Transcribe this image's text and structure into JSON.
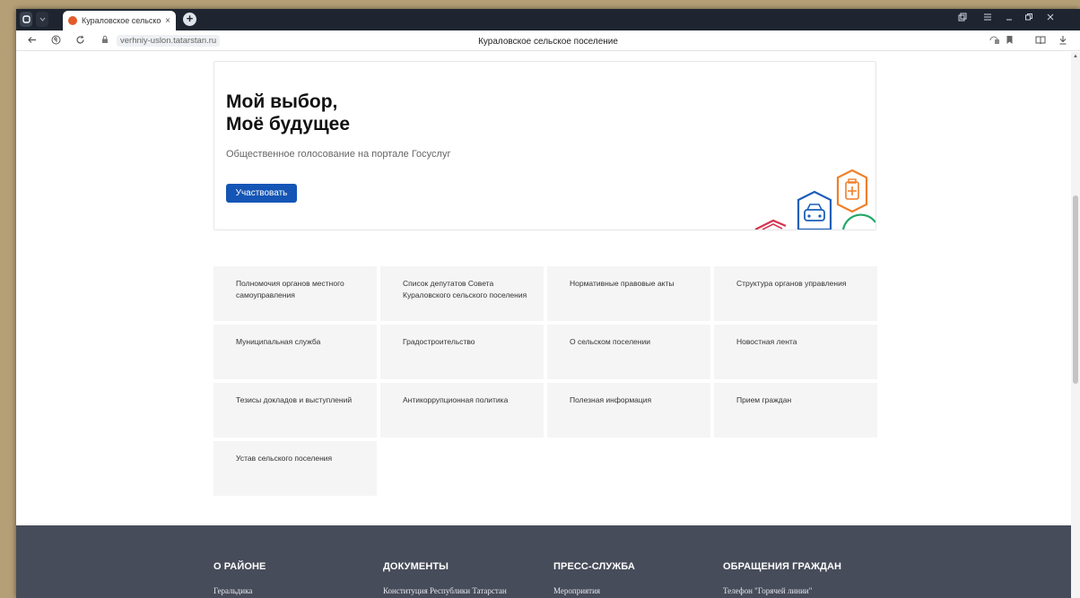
{
  "browser": {
    "tab_title": "Кураловское сельское",
    "tab_close": "×",
    "new_tab": "+",
    "url": "verhniy-uslon.tatarstan.ru",
    "page_title": "Кураловское сельское поселение"
  },
  "banner": {
    "title_line1": "Мой выбор,",
    "title_line2": "Моё будущее",
    "subtitle": "Общественное голосование на портале Госуслуг",
    "button_label": "Участвовать"
  },
  "tiles": [
    "Полномочия органов местного самоуправления",
    "Список депутатов Совета Кураловского сельского поселения",
    "Нормативные правовые акты",
    "Структура органов управления",
    "Муниципальная служба",
    "Градостроительство",
    "О сельском поселении",
    "Новостная лента",
    "Тезисы докладов и выступлений",
    "Антикоррупционная политика",
    "Полезная информация",
    "Прием граждан",
    "Устав сельского поселения"
  ],
  "footer": {
    "columns": [
      {
        "heading": "О РАЙОНЕ",
        "link": "Геральдика"
      },
      {
        "heading": "ДОКУМЕНТЫ",
        "link": "Конституция Республики Татарстан"
      },
      {
        "heading": "ПРЕСС-СЛУЖБА",
        "link": "Мероприятия"
      },
      {
        "heading": "ОБРАЩЕНИЯ ГРАЖДАН",
        "link": "Телефон \"Горячей линии\""
      }
    ]
  },
  "colors": {
    "button_blue": "#1455b5",
    "footer_bg": "#474c5a",
    "tile_bg": "#f5f5f5",
    "tab_bar": "#1e2530"
  }
}
